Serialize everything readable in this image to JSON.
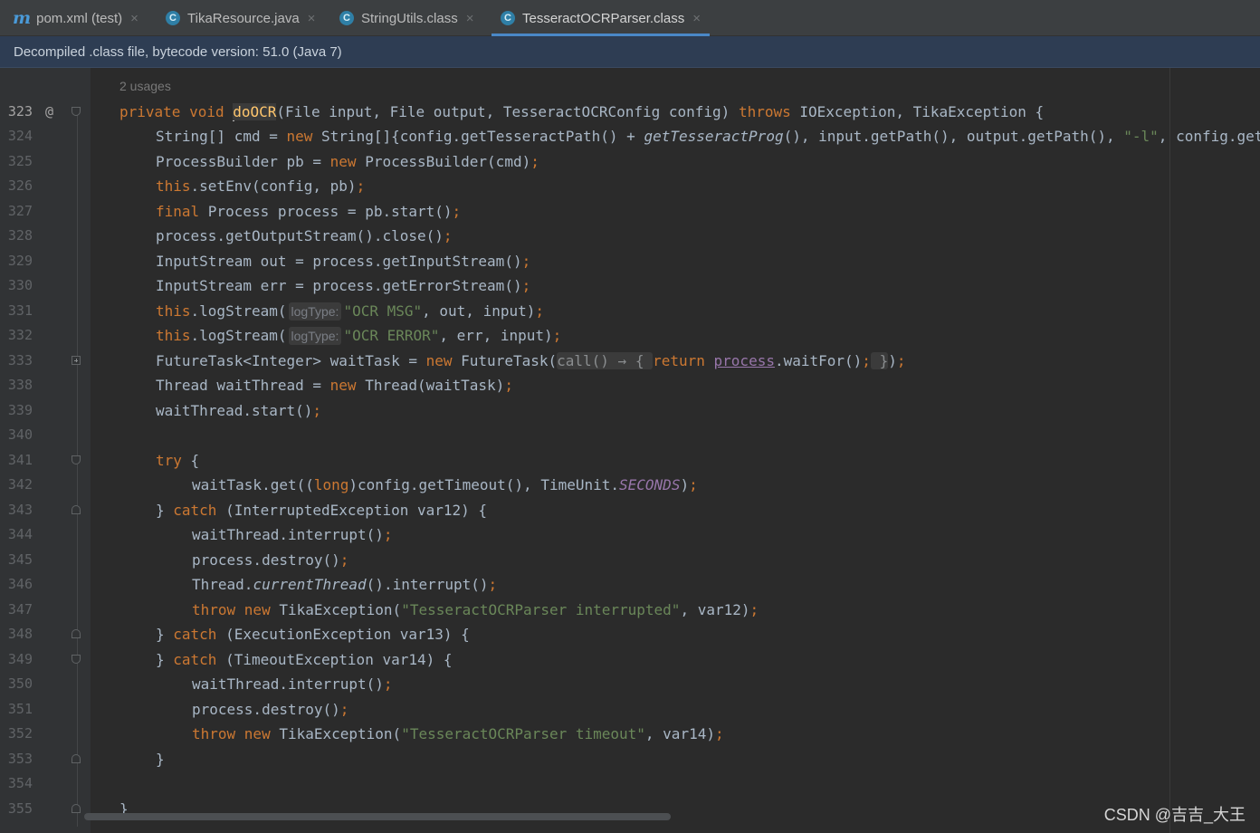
{
  "tabs": [
    {
      "label": "pom.xml (test)",
      "icon": "maven-icon",
      "active": false
    },
    {
      "label": "TikaResource.java",
      "icon": "class-icon",
      "active": false
    },
    {
      "label": "StringUtils.class",
      "icon": "class-icon",
      "active": false
    },
    {
      "label": "TesseractOCRParser.class",
      "icon": "class-icon",
      "active": true
    }
  ],
  "tab_icon_letters": {
    "maven": "m",
    "class": "C"
  },
  "tab_close_glyph": "×",
  "banner": {
    "text": "Decompiled .class file, bytecode version: 51.0 (Java 7)"
  },
  "editor": {
    "usages": "2 usages",
    "override_marker": "@",
    "line_numbers": [
      "323",
      "324",
      "325",
      "326",
      "327",
      "328",
      "329",
      "330",
      "331",
      "332",
      "333",
      "338",
      "339",
      "340",
      "341",
      "342",
      "343",
      "344",
      "345",
      "346",
      "347",
      "348",
      "349",
      "350",
      "351",
      "352",
      "353",
      "354",
      "355"
    ]
  },
  "watermark": "CSDN @吉吉_大王",
  "colors": {
    "background": "#2b2b2b",
    "gutter": "#313335",
    "keyword": "#cc7832",
    "string": "#6a8759",
    "constant": "#9876aa",
    "text": "#a9b7c6",
    "banner": "#2e3d53",
    "tab_underline": "#4a88c7"
  }
}
